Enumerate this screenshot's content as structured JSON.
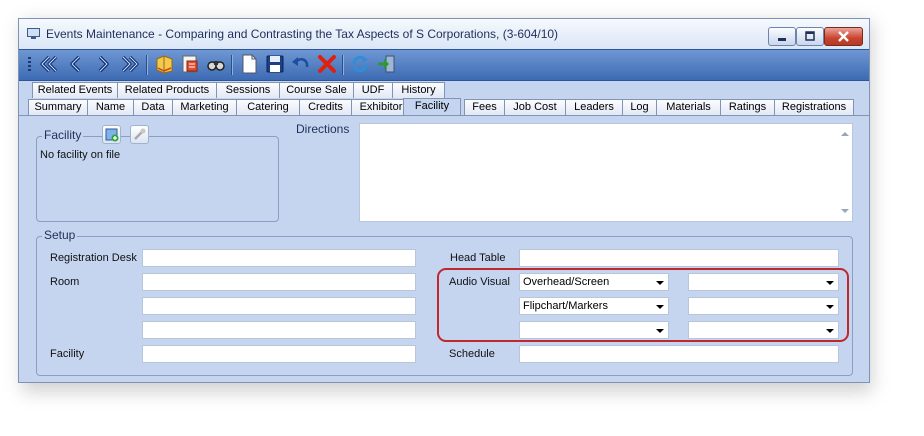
{
  "window": {
    "title": "Events Maintenance - Comparing and Contrasting the Tax Aspects of S Corporations, (3-604/10)",
    "app_icon": "monitor-icon"
  },
  "toolbar": {
    "icons": [
      "first-record-icon",
      "previous-record-icon",
      "next-record-icon",
      "last-record-icon",
      "book-icon",
      "report-icon",
      "binoculars-icon",
      "new-document-icon",
      "save-icon",
      "undo-icon",
      "delete-icon",
      "refresh-icon",
      "exit-icon"
    ]
  },
  "tabs": {
    "row1": [
      "Related Events",
      "Related Products",
      "Sessions",
      "Course Sale",
      "UDF",
      "History"
    ],
    "row2": [
      "Summary",
      "Name",
      "Data",
      "Marketing",
      "Catering",
      "Credits",
      "Exhibitor",
      "Facility",
      "Fees",
      "Job Cost",
      "Leaders",
      "Log",
      "Materials",
      "Ratings",
      "Registrations"
    ],
    "active": "Facility"
  },
  "facility": {
    "group_label": "Facility",
    "value": "No facility on file",
    "add_icon": "add-facility-icon",
    "edit_icon": "edit-facility-icon"
  },
  "directions": {
    "label": "Directions",
    "value": ""
  },
  "setup": {
    "group_label": "Setup",
    "registration_desk_label": "Registration Desk",
    "room_label": "Room",
    "facility_label": "Facility",
    "head_table_label": "Head Table",
    "audio_visual_label": "Audio Visual",
    "schedule_label": "Schedule",
    "registration_desk": "",
    "room": [
      "",
      "",
      ""
    ],
    "facility": "",
    "head_table": "",
    "schedule": "",
    "audio_visual": {
      "col1": [
        "Overhead/Screen",
        "Flipchart/Markers",
        ""
      ],
      "col2": [
        "",
        "",
        ""
      ]
    }
  },
  "colors": {
    "highlight": "#c0282b",
    "toolbar": "#4a78bd",
    "panel": "#c5d5f0"
  }
}
